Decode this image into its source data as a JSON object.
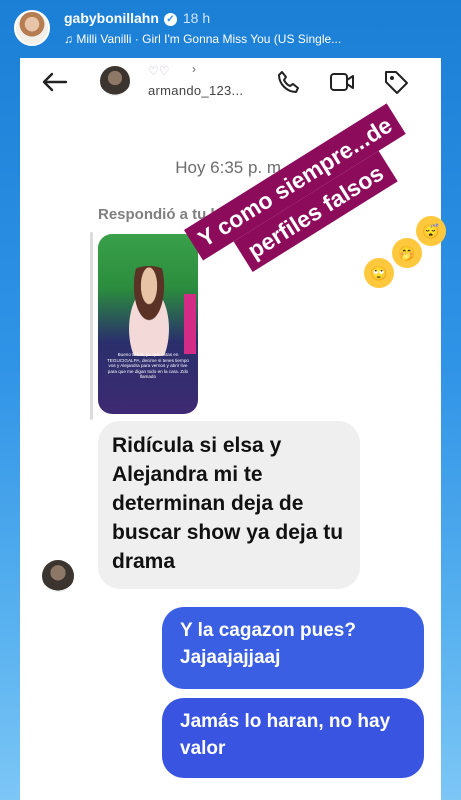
{
  "story": {
    "username": "gabybonillahn",
    "time": "18 h",
    "music": "Milli Vanilli · Girl I'm Gonna Miss You (US Single..."
  },
  "dm": {
    "username": "armando_123...",
    "hearts": "♡♡",
    "chevron": "›"
  },
  "chat": {
    "timestamp": "Hoy 6:35 p. m.",
    "reply_label": "Respondió a tu historia",
    "thumb_text": "Bueno Elsita, ya que estas en TEGUCIGALPA, decime si tenes tiempo vos y Alejandra para vernos y abrir live para que me digan todo en la cara. Zdo llamado",
    "incoming": "Ridícula si elsa y Alejandra mi te determinan deja de buscar show ya deja tu drama",
    "outgoing": [
      "Y la cagazon pues? Jajaajajjaaj",
      "Jamás lo haran, no hay valor"
    ]
  },
  "sticker": {
    "line1": "Y como siempre...de",
    "line2": "perfiles falsos",
    "emoji": [
      "🙄",
      "🤭",
      "😴"
    ]
  },
  "icons": [
    "back-arrow-icon",
    "phone-icon",
    "video-icon",
    "tag-icon",
    "verified-icon",
    "music-icon"
  ],
  "colors": {
    "background_top": "#1b7fd6",
    "outgoing_bubble": "#3b5fe3",
    "incoming_bubble": "#efefef",
    "sticker": "#8d0b5b"
  }
}
